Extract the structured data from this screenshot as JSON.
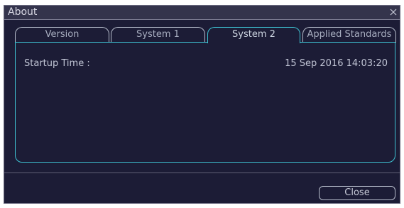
{
  "dialog": {
    "title": "About"
  },
  "icons": {
    "close": "close-icon"
  },
  "tabs": [
    {
      "label": "Version",
      "active": false
    },
    {
      "label": "System 1",
      "active": false
    },
    {
      "label": "System 2",
      "active": true
    },
    {
      "label": "Applied Standards",
      "active": false
    }
  ],
  "panel": {
    "rows": [
      {
        "label": "Startup Time :",
        "value": "15 Sep 2016 14:03:20"
      }
    ]
  },
  "footer": {
    "close_label": "Close"
  },
  "colors": {
    "background": "#1c1c36",
    "accent": "#3ec2d2",
    "text": "#c0c4d4"
  }
}
